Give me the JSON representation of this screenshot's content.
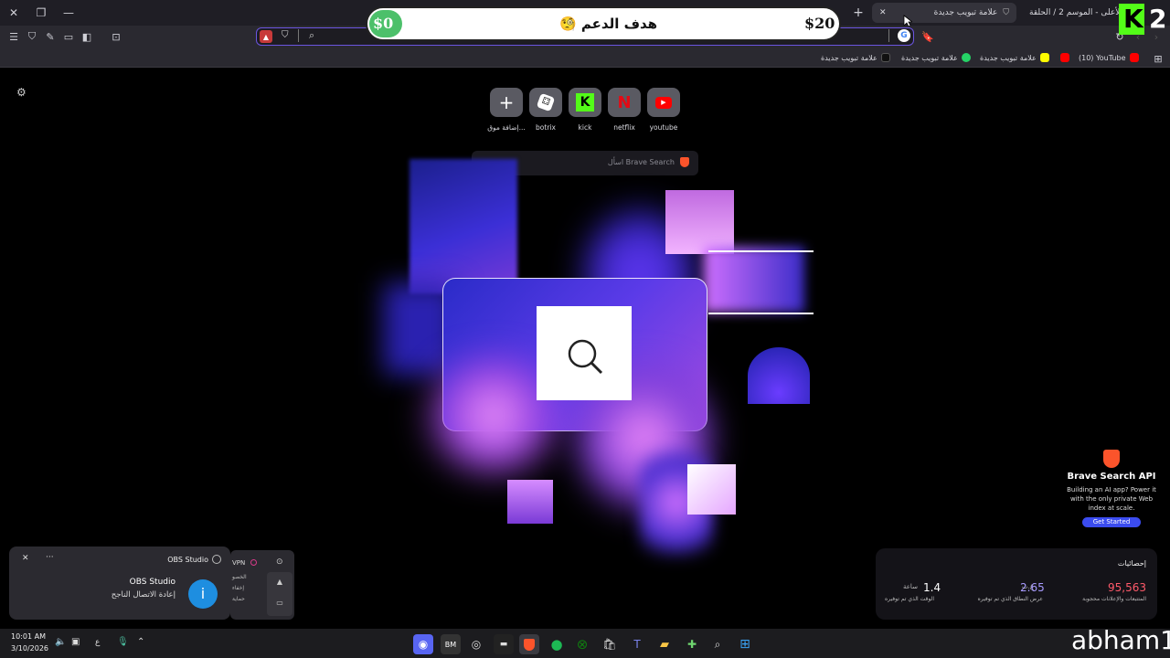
{
  "window": {
    "tabs": [
      {
        "label": "علامة تبويب جديدة",
        "active": true
      },
      {
        "label": "ع الأعلى - الموسم 2 / الحلقة",
        "active": false
      }
    ]
  },
  "overlay": {
    "donation": {
      "start": "$0",
      "title": "🧐 هدف الدعم",
      "goal": "$20",
      "progress": 0
    },
    "kick_badge": {
      "letter": "K",
      "count": "2"
    },
    "streamer_name": "abham1"
  },
  "bookmarks": [
    {
      "label": "علامة تبويب جديدة",
      "icon": "tiktok-icon"
    },
    {
      "label": "علامة تبويب جديدة",
      "icon": "whatsapp-icon"
    },
    {
      "label": "علامة تبويب جديدة",
      "icon": "snapchat-icon"
    },
    {
      "label": "",
      "icon": "youtube-icon"
    },
    {
      "label": "(10) YouTube",
      "icon": "youtube-icon"
    }
  ],
  "shortcuts": [
    {
      "label": "youtube",
      "color": "#ff0000"
    },
    {
      "label": "netflix",
      "color": "#e50914"
    },
    {
      "label": "kick",
      "color": "#53fc18"
    },
    {
      "label": "botrix",
      "color": "#ffffff"
    },
    {
      "label": "إضافة موق...",
      "color": "#ffffff"
    }
  ],
  "search": {
    "placeholder": "اسأل Brave Search"
  },
  "brave_api": {
    "title": "Brave Search API",
    "body": "Building an AI app? Power it with the only private Web index at scale.",
    "cta": "Get Started"
  },
  "stats": {
    "title": "إحصائيات",
    "items": [
      {
        "value": "95,563",
        "unit": "",
        "label": "المتتبعات والإعلانات محجوبة",
        "color": "#ff5a6a"
      },
      {
        "value": "2.65",
        "unit": "غ.ب",
        "label": "عرض النطاق الذي تم توفيره",
        "color": "#a89bff"
      },
      {
        "value": "1.4",
        "unit": "ساعة",
        "label": "الوقت الذي تم توفيره",
        "color": "#ffffff"
      }
    ]
  },
  "notification": {
    "app": "OBS Studio",
    "title": "OBS Studio",
    "message": "إعادة الاتصال الناجح"
  },
  "vpn_panel": {
    "label": "VPN",
    "rows": [
      "الخصو",
      "إخفاء",
      "حماية"
    ]
  },
  "clock": {
    "time": "10:01 AM",
    "date": "3/10/2026"
  },
  "lang": "ع"
}
